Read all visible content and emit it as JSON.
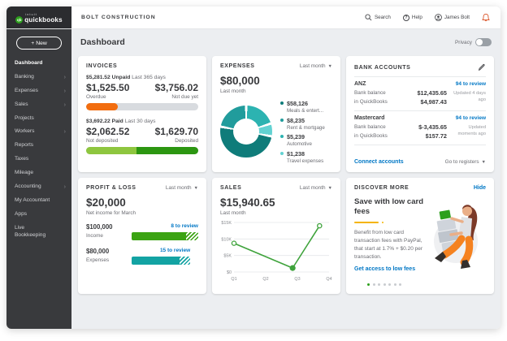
{
  "brand": {
    "intuit": "intuit",
    "name": "quickbooks"
  },
  "header": {
    "company": "BOLT CONSTRUCTION",
    "search_label": "Search",
    "help_label": "Help",
    "user_name": "James Bolt"
  },
  "sidebar": {
    "new_button": "New",
    "items": [
      {
        "label": "Dashboard",
        "active": true,
        "expandable": false
      },
      {
        "label": "Banking",
        "active": false,
        "expandable": true
      },
      {
        "label": "Expenses",
        "active": false,
        "expandable": true
      },
      {
        "label": "Sales",
        "active": false,
        "expandable": true
      },
      {
        "label": "Projects",
        "active": false,
        "expandable": false
      },
      {
        "label": "Workers",
        "active": false,
        "expandable": true
      },
      {
        "label": "Reports",
        "active": false,
        "expandable": false
      },
      {
        "label": "Taxes",
        "active": false,
        "expandable": false
      },
      {
        "label": "Mileage",
        "active": false,
        "expandable": false
      },
      {
        "label": "Accounting",
        "active": false,
        "expandable": true
      },
      {
        "label": "My Accountant",
        "active": false,
        "expandable": false
      },
      {
        "label": "Apps",
        "active": false,
        "expandable": false
      },
      {
        "label": "Live Bookkeeping",
        "active": false,
        "expandable": false
      }
    ]
  },
  "page": {
    "title": "Dashboard",
    "privacy_label": "Privacy"
  },
  "invoices": {
    "title": "INVOICES",
    "unpaid_amount": "$5,281.52",
    "unpaid_label": "Unpaid",
    "unpaid_period": "Last 365 days",
    "overdue_amount": "$1,525.50",
    "overdue_label": "Overdue",
    "notdue_amount": "$3,756.02",
    "notdue_label": "Not due yet",
    "unpaid_bar": {
      "fill_pct": 28,
      "fill_color": "#f26d0f",
      "track_color": "#d8dbdf"
    },
    "paid_amount": "$3,692.22",
    "paid_label": "Paid",
    "paid_period": "Last 30 days",
    "notdeposited_amount": "$2,062.52",
    "notdeposited_label": "Not deposited",
    "deposited_amount": "$1,629.70",
    "deposited_label": "Deposited",
    "paid_bar": {
      "left_pct": 45,
      "left_color": "#8ec63f",
      "right_color": "#2c9611"
    }
  },
  "expenses": {
    "title": "EXPENSES",
    "period_selector": "Last month",
    "total": "$80,000",
    "subtitle": "Last month"
  },
  "bank_accounts": {
    "title": "BANK ACCOUNTS",
    "accounts": [
      {
        "name": "ANZ",
        "review_link": "94 to review",
        "bank_balance_label": "Bank balance",
        "bank_balance": "$12,435.65",
        "qb_label": "in QuickBooks",
        "qb_balance": "$4,987.43",
        "updated": "Updated 4 days ago"
      },
      {
        "name": "Mastercard",
        "review_link": "94 to review",
        "bank_balance_label": "Bank balance",
        "bank_balance": "$-3,435.65",
        "qb_label": "in QuickBooks",
        "qb_balance": "$157.72",
        "updated": "Updated moments ago"
      }
    ],
    "connect_link": "Connect accounts",
    "registers_link": "Go to registers"
  },
  "profit_loss": {
    "title": "PROFIT & LOSS",
    "period_selector": "Last month",
    "net_income": "$20,000",
    "subtitle": "Net income for March",
    "rows": [
      {
        "amount": "$100,000",
        "label": "Income",
        "review": "8 to review",
        "color": "#3ba313",
        "total_pct": 100,
        "solid_pct": 82
      },
      {
        "amount": "$80,000",
        "label": "Expenses",
        "review": "15 to review",
        "color": "#13a3a3",
        "total_pct": 88,
        "solid_pct": 72
      }
    ]
  },
  "sales": {
    "title": "SALES",
    "period_selector": "Last month",
    "total": "$15,940.65",
    "subtitle": "Last month"
  },
  "discover": {
    "title": "DISCOVER MORE",
    "hide_link": "Hide",
    "headline": "Save with low card fees",
    "body": "Benefit from low card transaction fees with PayPal, that start at 1.7% + $0.20 per transaction.",
    "cta": "Get access to low fees",
    "accent_color": "#f5b400",
    "dots_total": 7,
    "dots_active": 1
  },
  "chart_data": [
    {
      "type": "pie",
      "title": "EXPENSES",
      "total_label": "$80,000",
      "period": "Last month",
      "legend": [
        {
          "value": "$58,126",
          "label": "Meals & entert...",
          "color": "#0f7c7a"
        },
        {
          "value": "$8,235",
          "label": "Rent & mortgage",
          "color": "#219c9c"
        },
        {
          "value": "$5,239",
          "label": "Automotive",
          "color": "#2cb3b1"
        },
        {
          "value": "$1,238",
          "label": "Travel expenses",
          "color": "#62d2d2"
        }
      ],
      "arcs": [
        {
          "color": "#2cb3b1",
          "pct": 20
        },
        {
          "color": "#62d2d2",
          "pct": 8
        },
        {
          "color": "#0f7c7a",
          "pct": 50
        },
        {
          "color": "#219c9c",
          "pct": 22
        }
      ]
    },
    {
      "type": "line",
      "title": "SALES",
      "color": "#3fa33c",
      "x_ticks": [
        "Q1",
        "Q2",
        "Q3",
        "Q4"
      ],
      "y_ticks": [
        {
          "label": "$0",
          "value": 0
        },
        {
          "label": "$5K",
          "value": 5000
        },
        {
          "label": "$10K",
          "value": 10000
        },
        {
          "label": "$15K",
          "value": 15000
        }
      ],
      "y_max": 15000,
      "points": [
        {
          "x": 1,
          "y": 8700,
          "marker": "open"
        },
        {
          "x": 2.85,
          "y": 1200,
          "marker": "filled"
        },
        {
          "x": 3.7,
          "y": 14000,
          "marker": "open"
        }
      ]
    }
  ]
}
